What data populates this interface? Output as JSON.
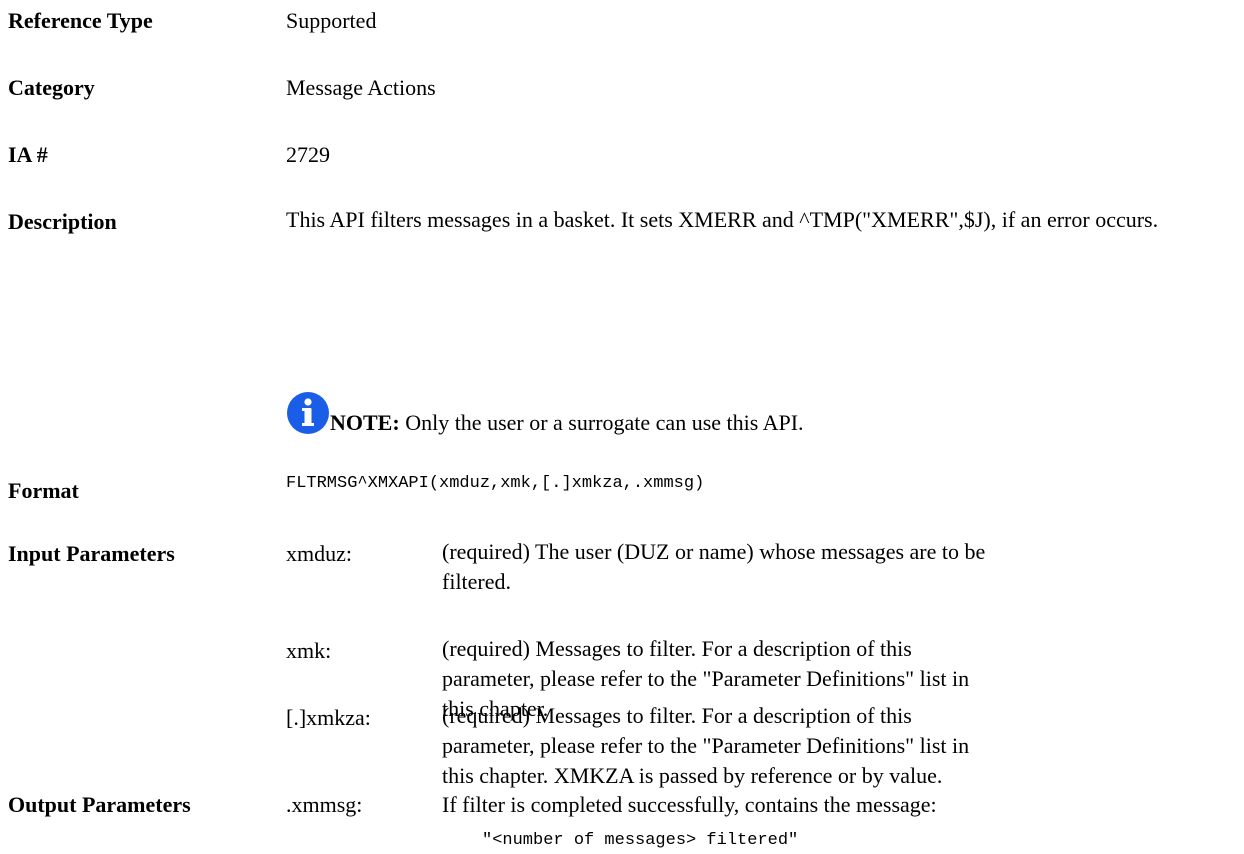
{
  "rows": {
    "reference_type": {
      "label": "Reference Type",
      "value": "Supported"
    },
    "category": {
      "label": "Category",
      "value": "Message Actions"
    },
    "ia": {
      "label": "IA #",
      "value": "2729"
    },
    "description": {
      "label": "Description",
      "text": "This API filters messages in a basket. It sets XMERR and ^TMP(\"XMERR\",$J), if an error occurs."
    },
    "note": {
      "icon": "info-icon",
      "prefix": "NOTE:",
      "text": " Only the user or a surrogate can use this API."
    },
    "format": {
      "label": "Format",
      "value": "FLTRMSG^XMXAPI(xmduz,xmk,[.]xmkza,.xmmsg)"
    },
    "input": {
      "label": "Input Parameters",
      "params": [
        {
          "name": "xmduz:",
          "text": "(required) The user (DUZ or name) whose messages are to be filtered."
        },
        {
          "name": "xmk:",
          "text": "(required) Messages to filter. For a description of this parameter, please refer to the \"Parameter Definitions\" list in this chapter."
        },
        {
          "name": "[.]xmkza:",
          "text": "(required) Messages to filter. For a description of this parameter, please refer to the \"Parameter Definitions\" list in this chapter. XMKZA is passed by reference or by value."
        }
      ]
    },
    "output": {
      "label": "Output Parameters",
      "params": [
        {
          "name": ".xmmsg:",
          "text": "If filter is completed successfully, contains the message:",
          "code": "\"<number of messages> filtered\""
        }
      ]
    }
  },
  "colors": {
    "info_icon": "#1a5ee8"
  }
}
